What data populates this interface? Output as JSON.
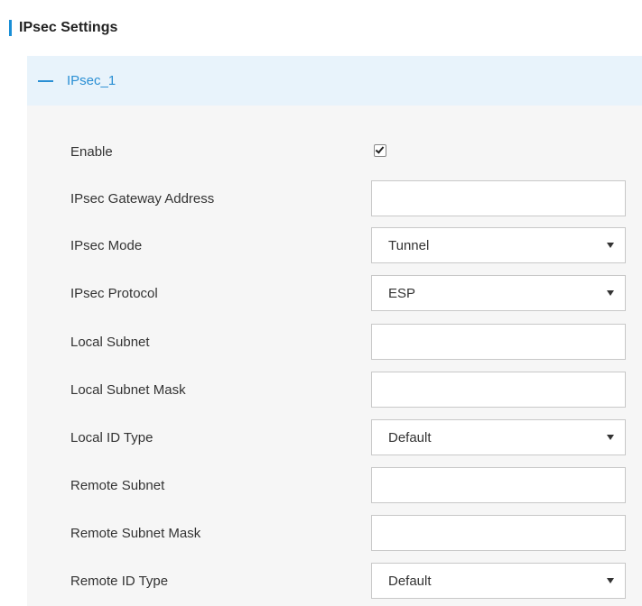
{
  "section": {
    "title": "IPsec Settings"
  },
  "panel": {
    "title": "IPsec_1"
  },
  "fields": {
    "enable": {
      "label": "Enable",
      "checked": true
    },
    "gateway": {
      "label": "IPsec Gateway Address",
      "value": ""
    },
    "mode": {
      "label": "IPsec Mode",
      "value": "Tunnel"
    },
    "protocol": {
      "label": "IPsec Protocol",
      "value": "ESP"
    },
    "local_subnet": {
      "label": "Local Subnet",
      "value": ""
    },
    "local_subnet_mask": {
      "label": "Local Subnet Mask",
      "value": ""
    },
    "local_id_type": {
      "label": "Local ID Type",
      "value": "Default"
    },
    "remote_subnet": {
      "label": "Remote Subnet",
      "value": ""
    },
    "remote_subnet_mask": {
      "label": "Remote Subnet Mask",
      "value": ""
    },
    "remote_id_type": {
      "label": "Remote ID Type",
      "value": "Default"
    }
  },
  "colors": {
    "accent": "#2a8fd4",
    "header_bg": "#e8f3fb",
    "panel_bg": "#f6f6f6"
  }
}
